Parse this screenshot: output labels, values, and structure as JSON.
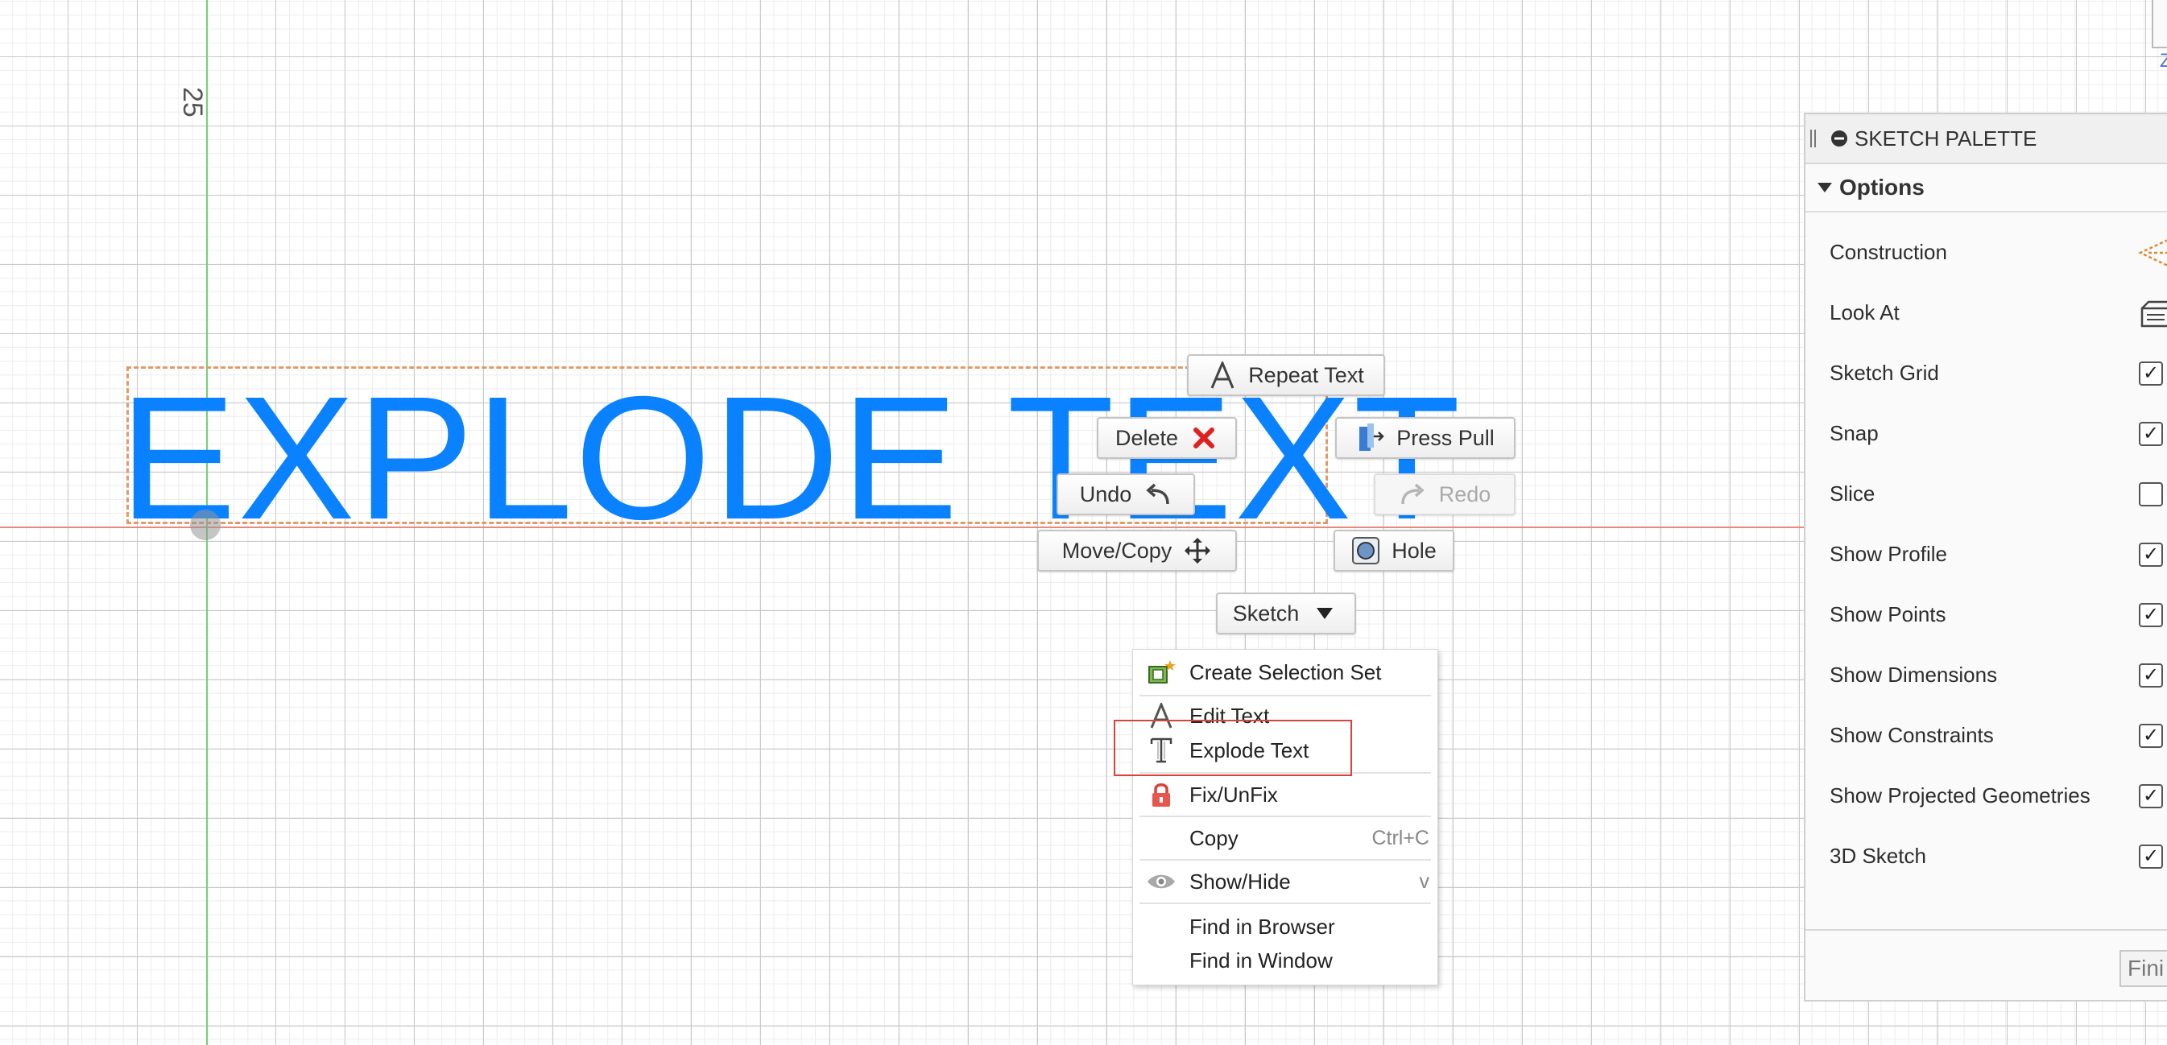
{
  "canvas": {
    "dimension_label": "25",
    "sketch_text": "EXPLODE TEXT"
  },
  "marking_menu": {
    "repeat_text": "Repeat Text",
    "delete": "Delete",
    "press_pull": "Press Pull",
    "undo": "Undo",
    "redo": "Redo",
    "move_copy": "Move/Copy",
    "hole": "Hole",
    "sketch_dropdown": "Sketch"
  },
  "context_menu": {
    "items": [
      {
        "label": "Create Selection Set",
        "icon": "selection-set-icon"
      },
      {
        "label": "Edit Text",
        "icon": "text-a-icon"
      },
      {
        "label": "Explode Text",
        "icon": "explode-text-icon"
      },
      {
        "label": "Fix/UnFix",
        "icon": "lock-icon"
      },
      {
        "label": "Copy",
        "shortcut": "Ctrl+C"
      },
      {
        "label": "Show/Hide",
        "shortcut": "v",
        "icon": "eye-icon"
      },
      {
        "label": "Find in Browser"
      },
      {
        "label": "Find in Window"
      }
    ]
  },
  "palette": {
    "title": "SKETCH PALETTE",
    "section": "Options",
    "options": [
      {
        "label": "Construction",
        "control": "construction-icon"
      },
      {
        "label": "Look At",
        "control": "look-at-icon"
      },
      {
        "label": "Sketch Grid",
        "checked": true
      },
      {
        "label": "Snap",
        "checked": true
      },
      {
        "label": "Slice",
        "checked": false
      },
      {
        "label": "Show Profile",
        "checked": true
      },
      {
        "label": "Show Points",
        "checked": true
      },
      {
        "label": "Show Dimensions",
        "checked": true
      },
      {
        "label": "Show Constraints",
        "checked": true
      },
      {
        "label": "Show Projected Geometries",
        "checked": true
      },
      {
        "label": "3D Sketch",
        "checked": true
      }
    ],
    "finish_label": "Fini"
  },
  "colors": {
    "sketch_text": "#0a82ff",
    "highlight": "#d9443a",
    "selection_box": "#e39a66",
    "y_axis": "#6fd46f",
    "x_axis": "#e88a7c"
  }
}
